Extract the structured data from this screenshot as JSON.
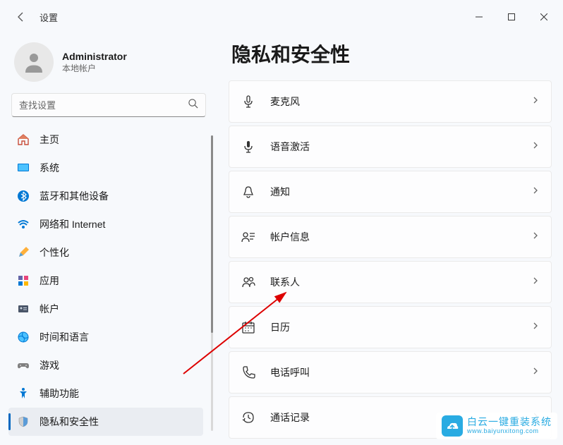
{
  "window": {
    "title": "设置"
  },
  "user": {
    "name": "Administrator",
    "subtitle": "本地帐户"
  },
  "search": {
    "placeholder": "查找设置"
  },
  "nav": {
    "items": [
      {
        "icon": "home",
        "label": "主页"
      },
      {
        "icon": "system",
        "label": "系统"
      },
      {
        "icon": "bluetooth",
        "label": "蓝牙和其他设备"
      },
      {
        "icon": "network",
        "label": "网络和 Internet"
      },
      {
        "icon": "personalize",
        "label": "个性化"
      },
      {
        "icon": "apps",
        "label": "应用"
      },
      {
        "icon": "accounts",
        "label": "帐户"
      },
      {
        "icon": "time",
        "label": "时间和语言"
      },
      {
        "icon": "gaming",
        "label": "游戏"
      },
      {
        "icon": "accessibility",
        "label": "辅助功能"
      },
      {
        "icon": "privacy",
        "label": "隐私和安全性"
      }
    ],
    "activeIndex": 10
  },
  "main": {
    "title": "隐私和安全性",
    "cards": [
      {
        "icon": "microphone",
        "label": "麦克风"
      },
      {
        "icon": "voice",
        "label": "语音激活"
      },
      {
        "icon": "notifications",
        "label": "通知"
      },
      {
        "icon": "account-info",
        "label": "帐户信息"
      },
      {
        "icon": "contacts",
        "label": "联系人"
      },
      {
        "icon": "calendar",
        "label": "日历"
      },
      {
        "icon": "phone",
        "label": "电话呼叫"
      },
      {
        "icon": "history",
        "label": "通话记录"
      }
    ]
  },
  "watermark": {
    "line1": "白云一键重装系统",
    "line2": "www.baiyunxitong.com"
  }
}
